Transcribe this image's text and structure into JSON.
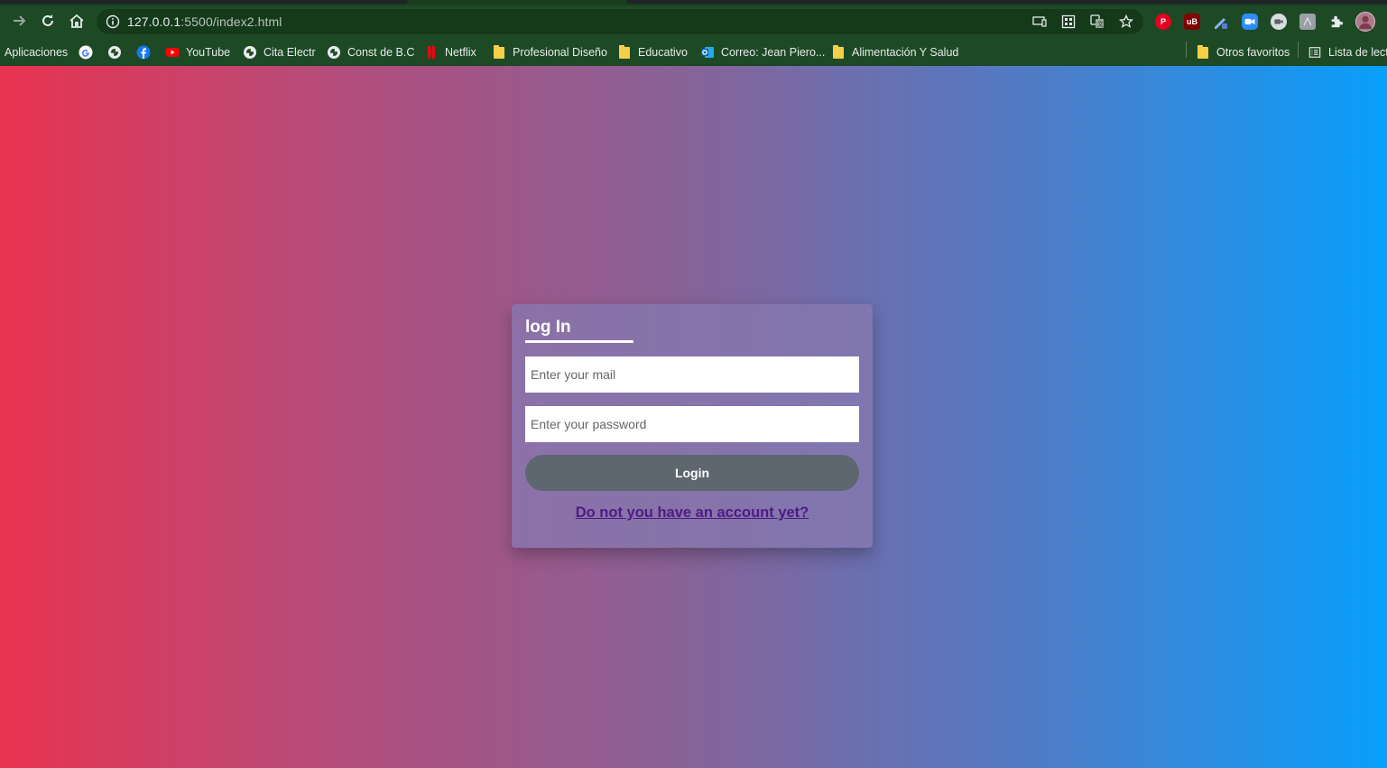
{
  "browser": {
    "url_host": "127.0.0.1",
    "url_rest": ":5500/index2.html",
    "bookmarks": [
      {
        "label": "Aplicaciones",
        "icon": "apps-grid-icon"
      },
      {
        "label": "",
        "icon": "google-icon"
      },
      {
        "label": "",
        "icon": "globe-icon"
      },
      {
        "label": "",
        "icon": "facebook-icon"
      },
      {
        "label": "YouTube",
        "icon": "youtube-icon"
      },
      {
        "label": "Cita Electr",
        "icon": "globe-icon"
      },
      {
        "label": "Const de B.C",
        "icon": "globe-icon"
      },
      {
        "label": "Netflix",
        "icon": "netflix-icon"
      },
      {
        "label": "Profesional Diseño",
        "icon": "folder-icon"
      },
      {
        "label": "Educativo",
        "icon": "folder-icon"
      },
      {
        "label": "Correo: Jean Piero...",
        "icon": "outlook-icon"
      },
      {
        "label": "Alimentación Y Salud",
        "icon": "folder-icon"
      }
    ],
    "other_bookmarks": "Otros favoritos",
    "reading_list": "Lista de lectura"
  },
  "login": {
    "title": "log In",
    "email_placeholder": "Enter your mail",
    "password_placeholder": "Enter your password",
    "login_button": "Login",
    "signup_link": "Do not you have an account yet?"
  },
  "colors": {
    "gradient_start": "#e83350",
    "gradient_end": "#079ffc",
    "card_background": "#8679b0",
    "button": "#5e666f",
    "link": "#4f1a86"
  }
}
